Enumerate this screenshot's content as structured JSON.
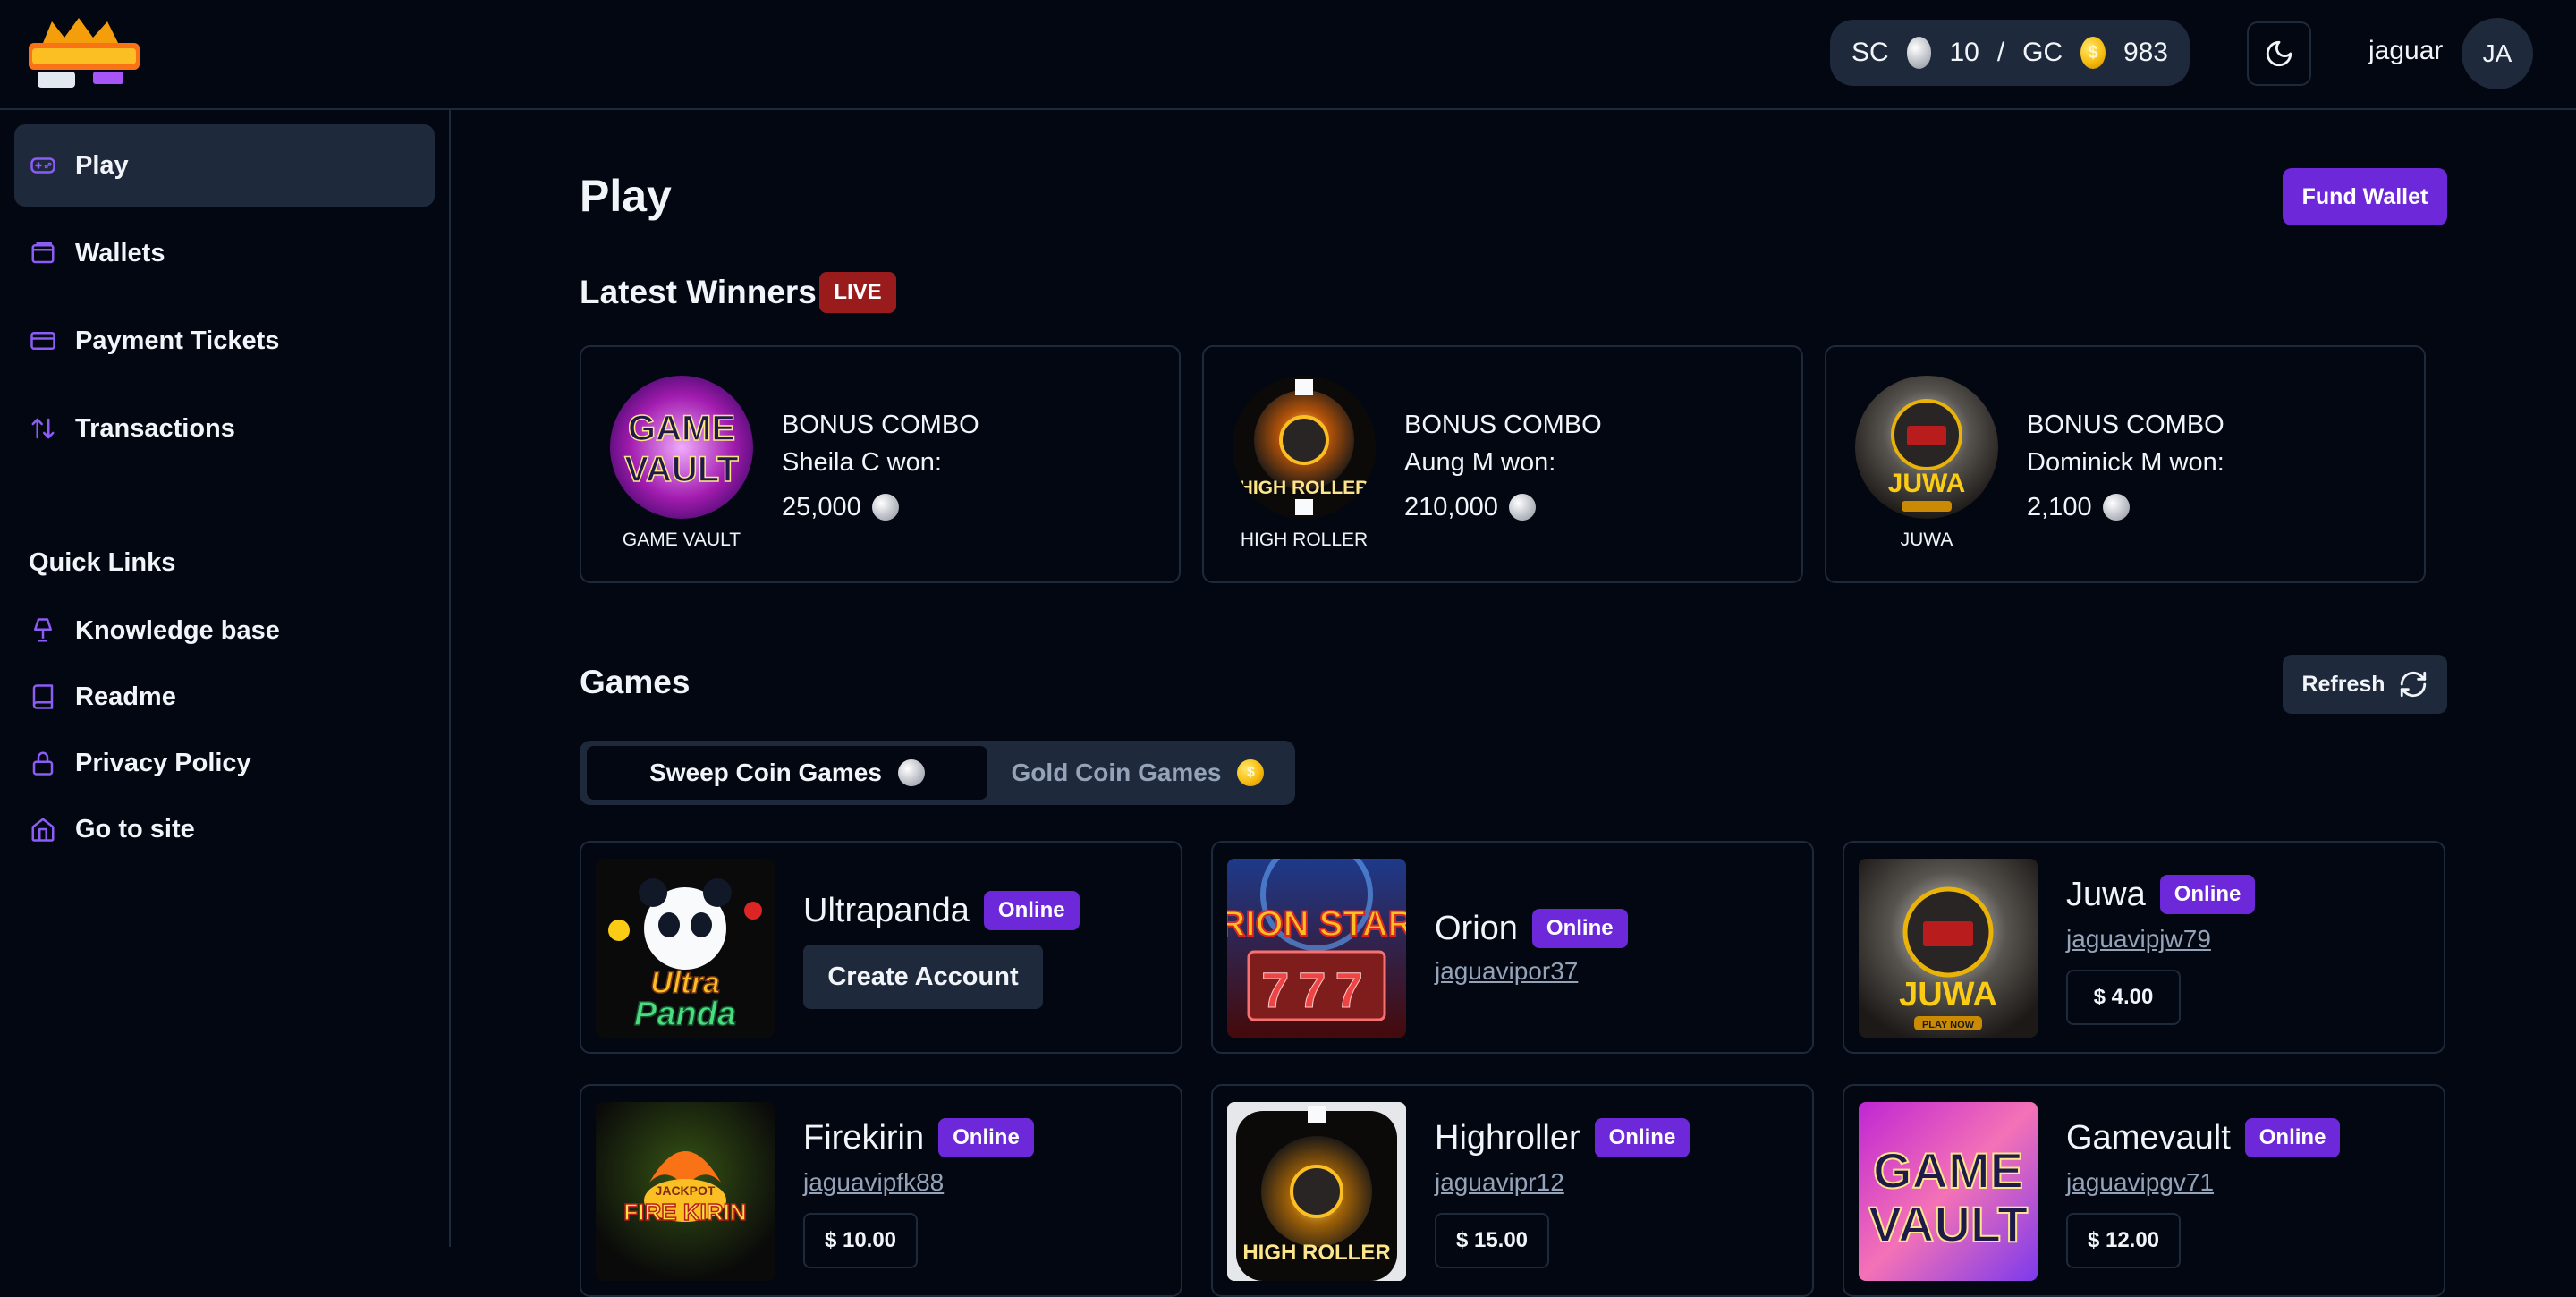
{
  "header": {
    "balance": {
      "sc_label": "SC",
      "sc_value": "10",
      "separator": "/",
      "gc_label": "GC",
      "gc_value": "983",
      "gc_coin_symbol": "$"
    },
    "username": "jaguar",
    "avatar_initials": "JA"
  },
  "sidebar": {
    "items": [
      {
        "label": "Play",
        "icon": "gamepad-icon",
        "active": true
      },
      {
        "label": "Wallets",
        "icon": "wallet-icon"
      },
      {
        "label": "Payment Tickets",
        "icon": "credit-card-icon"
      },
      {
        "label": "Transactions",
        "icon": "arrows-up-down-icon"
      }
    ],
    "quick_links_title": "Quick Links",
    "quick_links": [
      {
        "label": "Knowledge base",
        "icon": "lamp-icon"
      },
      {
        "label": "Readme",
        "icon": "book-icon"
      },
      {
        "label": "Privacy Policy",
        "icon": "lock-icon"
      },
      {
        "label": "Go to site",
        "icon": "home-icon"
      }
    ]
  },
  "main": {
    "title": "Play",
    "fund_wallet_label": "Fund Wallet",
    "latest_winners_title": "Latest Winners",
    "live_label": "LIVE",
    "winners": [
      {
        "game": "GAME VAULT",
        "prize": "BONUS COMBO",
        "winner": "Sheila C won:",
        "amount": "25,000"
      },
      {
        "game": "HIGH ROLLER",
        "prize": "BONUS COMBO",
        "winner": "Aung M won:",
        "amount": "210,000"
      },
      {
        "game": "JUWA",
        "prize": "BONUS COMBO",
        "winner": "Dominick M won:",
        "amount": "2,100"
      }
    ],
    "games_title": "Games",
    "refresh_label": "Refresh",
    "coin_tabs": {
      "sweep": "Sweep Coin Games",
      "gold": "Gold Coin Games",
      "gold_coin_symbol": "$"
    },
    "games": [
      {
        "name": "Ultrapanda",
        "status": "Online",
        "action": "Create Account",
        "art_text": "Ultra Panda"
      },
      {
        "name": "Orion",
        "status": "Online",
        "user": "jaguavipor37",
        "art_text": "RION STAR"
      },
      {
        "name": "Juwa",
        "status": "Online",
        "user": "jaguavipjw79",
        "balance": "$ 4.00",
        "art_text": "JUWA"
      },
      {
        "name": "Firekirin",
        "status": "Online",
        "user": "jaguavipfk88",
        "balance": "$ 10.00",
        "art_text": "FIRE KIRIN"
      },
      {
        "name": "Highroller",
        "status": "Online",
        "user": "jaguavipr12",
        "balance": "$ 15.00",
        "art_text": "HIGH ROLLER"
      },
      {
        "name": "Gamevault",
        "status": "Online",
        "user": "jaguavipgv71",
        "balance": "$ 12.00",
        "art_text": "GAME VAULT"
      }
    ],
    "art_labels": {
      "game_vault_line1": "GAME",
      "game_vault_line2": "VAULT",
      "juwa_sub": "PLAY NOW",
      "orion_digits": "777",
      "ultra": "Ultra",
      "panda": "Panda",
      "kirin_top": "JACKPOT"
    }
  }
}
